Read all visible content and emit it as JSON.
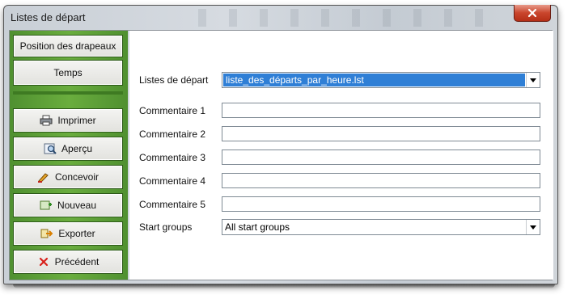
{
  "window": {
    "title": "Listes de départ"
  },
  "nav": {
    "position_drapeaux": "Position des drapeaux",
    "temps": "Temps"
  },
  "actions": {
    "imprimer": "Imprimer",
    "apercu": "Aperçu",
    "concevoir": "Concevoir",
    "nouveau": "Nouveau",
    "exporter": "Exporter",
    "precedent": "Précédent"
  },
  "form": {
    "listes_label": "Listes de départ",
    "listes_value": "liste_des_départs_par_heure.lst",
    "comment1_label": "Commentaire 1",
    "comment2_label": "Commentaire 2",
    "comment3_label": "Commentaire 3",
    "comment4_label": "Commentaire 4",
    "comment5_label": "Commentaire 5",
    "comment1_value": "",
    "comment2_value": "",
    "comment3_value": "",
    "comment4_value": "",
    "comment5_value": "",
    "startgroups_label": "Start groups",
    "startgroups_value": "All start groups"
  },
  "colors": {
    "panel_green": "#5a9a34",
    "selection_blue": "#2f7fd6",
    "close_red": "#c9452c"
  },
  "icons": {
    "imprimer": "printer-icon",
    "apercu": "preview-icon",
    "concevoir": "design-icon",
    "nouveau": "new-icon",
    "exporter": "export-icon",
    "precedent": "cross-icon",
    "close": "close-icon"
  }
}
